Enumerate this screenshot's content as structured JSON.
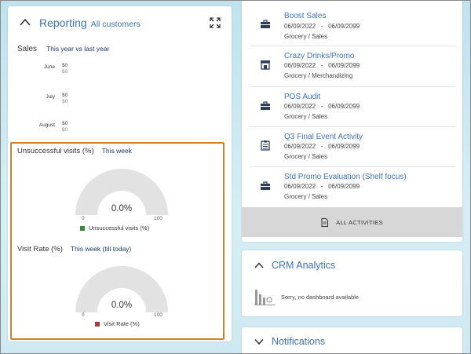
{
  "reporting": {
    "title": "Reporting",
    "subtitle": "All customers",
    "sales_label": "Sales",
    "sales_period": "This year vs last year",
    "months": [
      {
        "name": "June",
        "current": "$0",
        "previous": "$0"
      },
      {
        "name": "July",
        "current": "$0",
        "previous": "$0"
      },
      {
        "name": "August",
        "current": "$0",
        "previous": "$0"
      }
    ],
    "unsuccessful": {
      "title": "Unsuccessful visits (%)",
      "period": "This week",
      "value": "0.0%",
      "min": "0",
      "max": "100",
      "legend": "Unsuccessful visits (%)",
      "legend_color": "#3a8a3a",
      "fill_fraction": 0
    },
    "visit_rate": {
      "title": "Visit Rate (%)",
      "period": "This week (till today)",
      "value": "0.0%",
      "min": "0",
      "max": "100",
      "legend": "Visit Rate (%)",
      "legend_color": "#a83a3a",
      "fill_fraction": 0
    }
  },
  "activities": {
    "items": [
      {
        "icon": "briefcase-icon",
        "title": "Boost Sales",
        "start": "06/09/2022",
        "end": "06/09/2099",
        "category": "Grocery / Sales"
      },
      {
        "icon": "store-icon",
        "title": "Crazy Drinks/Promo",
        "start": "06/09/2022",
        "end": "06/09/2099",
        "category": "Grocery / Merchandizing"
      },
      {
        "icon": "briefcase-icon",
        "title": "POS Audit",
        "start": "06/09/2022",
        "end": "06/09/2099",
        "category": "Grocery / Sales"
      },
      {
        "icon": "clipboard-icon",
        "title": "Q3 Final Event Activity",
        "start": "06/09/2022",
        "end": "06/09/2099",
        "category": "Grocery / Sales"
      },
      {
        "icon": "briefcase-icon",
        "title": "Std Promo Evaluation (Shelf focus)",
        "start": "06/09/2022",
        "end": "06/09/2099",
        "category": "Grocery / Sales"
      }
    ],
    "date_separator": "-",
    "all_label": "ALL ACTIVITIES"
  },
  "crm": {
    "title": "CRM Analytics",
    "message": "Sorry, no dashboard available"
  },
  "notifications": {
    "title": "Notifications"
  },
  "colors": {
    "accent": "#3f73b8",
    "highlight": "#d4822a",
    "gauge_track": "#e2e2e2"
  }
}
